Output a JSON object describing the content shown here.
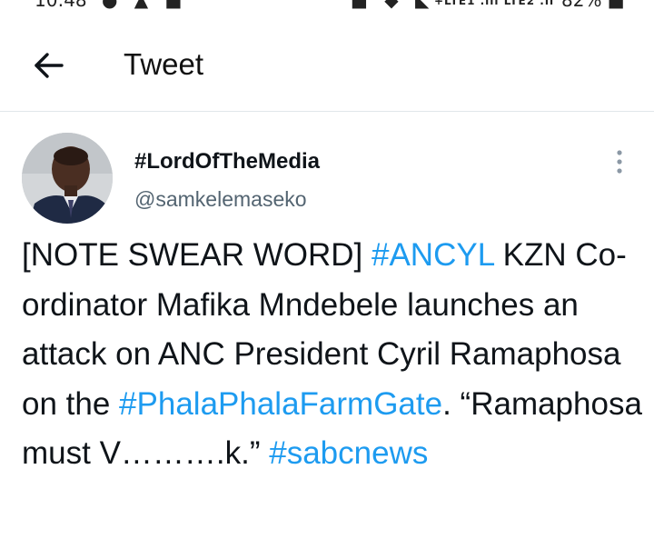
{
  "status_bar": {
    "time": "10:48",
    "lte_label": "+LTE1 .ııl LTE2 .ıı",
    "battery": "82%"
  },
  "header": {
    "title": "Tweet"
  },
  "author": {
    "display_name": "#LordOfTheMedia",
    "handle": "@samkelemaseko"
  },
  "tweet": {
    "seg1": "[NOTE SWEAR WORD] ",
    "tag1": "#ANCYL",
    "seg2": " KZN Co-ordinator Mafika Mndebele launches an attack on ANC President Cyril Ramaphosa on the ",
    "tag2": "#PhalaPhalaFarmGate",
    "seg3": ". “Ramaphosa must V……….k.” ",
    "tag3": "#sabcnews"
  },
  "colors": {
    "link": "#1d9bf0",
    "text": "#0f1419",
    "secondary": "#536471"
  },
  "icons": [
    "back-arrow-icon",
    "more-vertical-icon"
  ]
}
